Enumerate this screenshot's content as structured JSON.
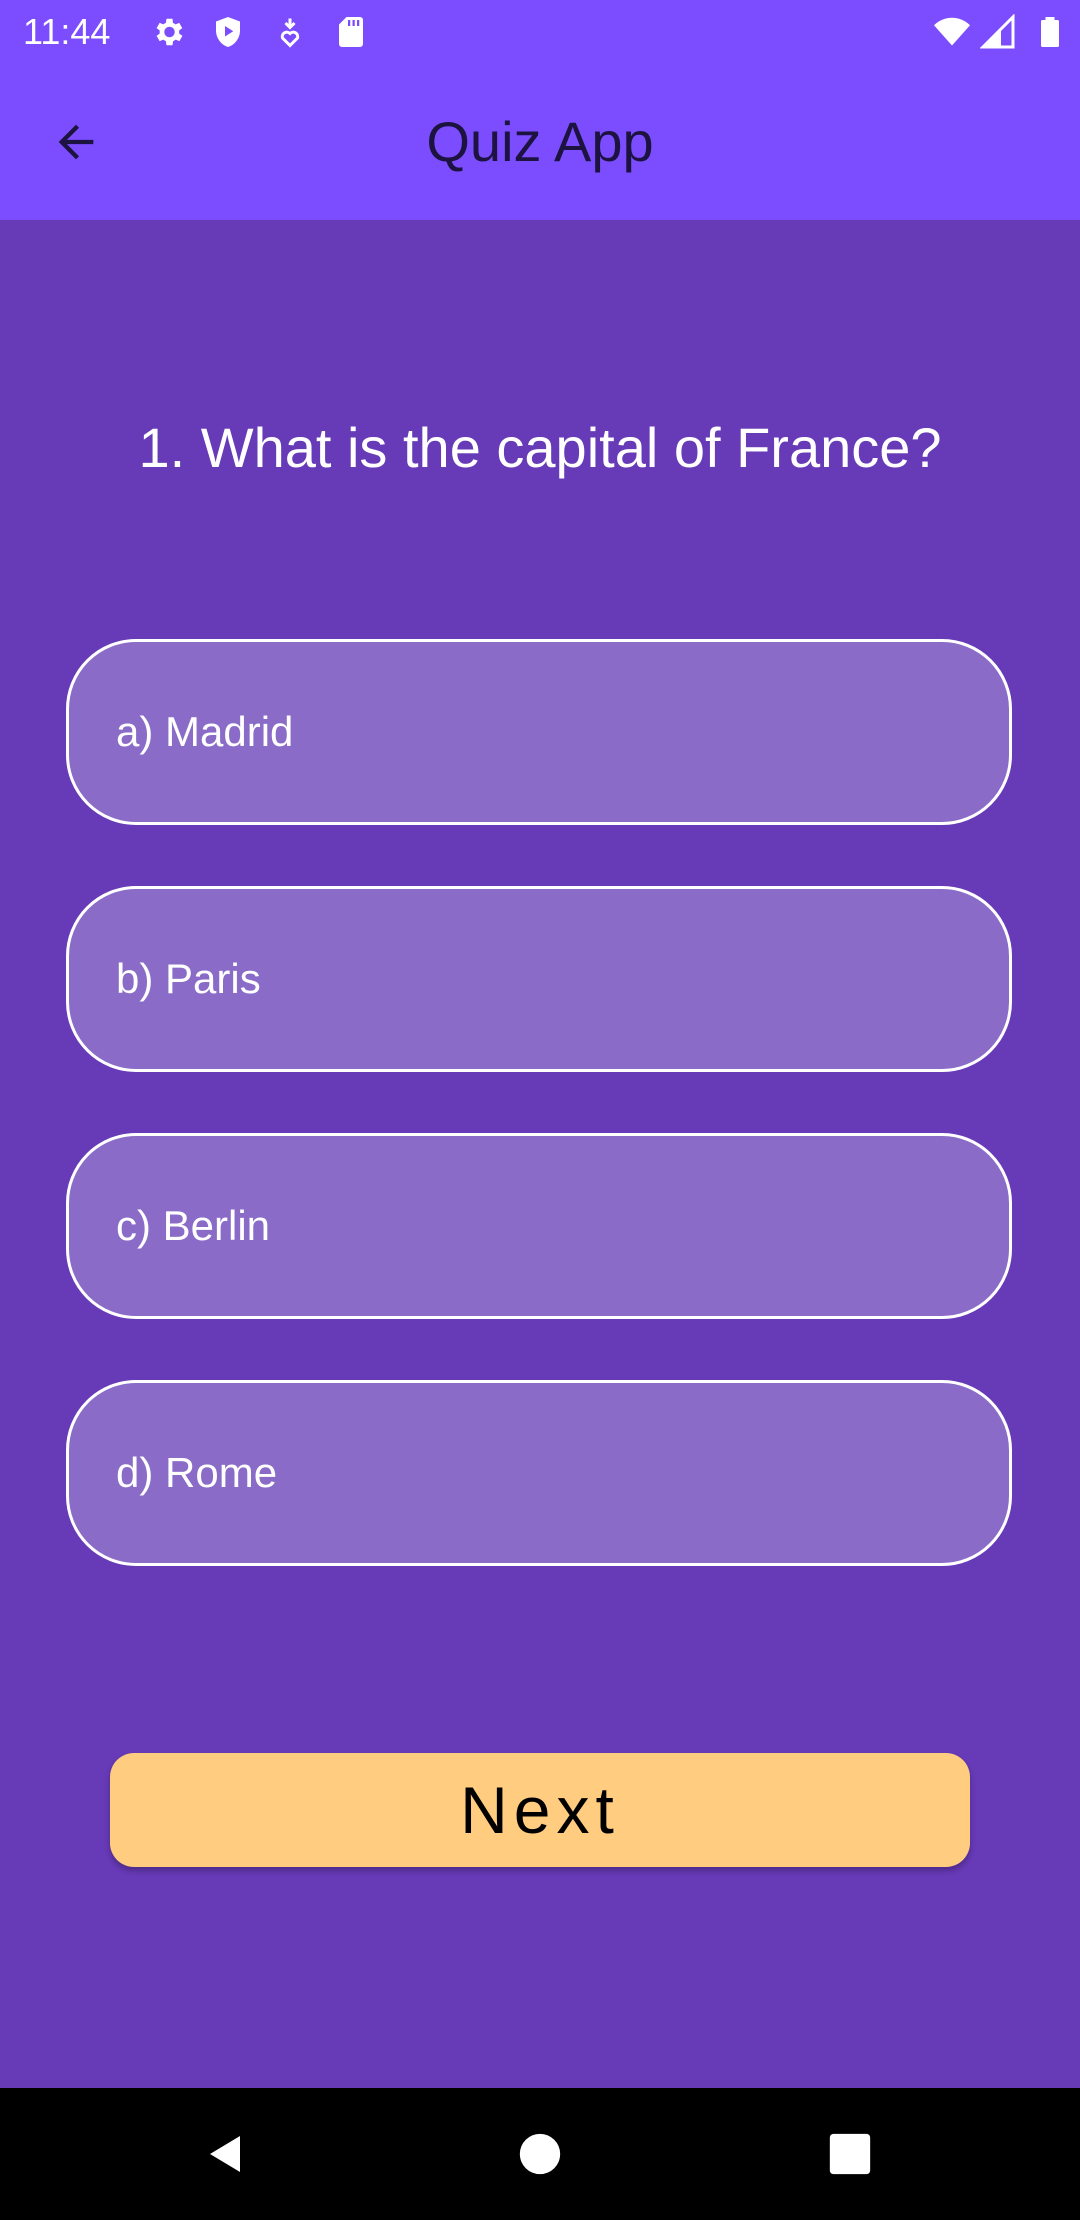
{
  "status_bar": {
    "time": "11:44",
    "left_icons": [
      "gear-icon",
      "shield-play-icon",
      "download-heart-icon",
      "sd-card-icon"
    ],
    "right_icons": [
      "wifi-icon",
      "signal-icon",
      "battery-icon"
    ]
  },
  "app_bar": {
    "title": "Quiz App",
    "back_icon": "arrow-back-icon",
    "color": "#7C4DFF"
  },
  "quiz": {
    "question": "1. What is the capital of France?",
    "options": [
      {
        "label": "a) Madrid"
      },
      {
        "label": "b) Paris"
      },
      {
        "label": "c) Berlin"
      },
      {
        "label": "d) Rome"
      }
    ],
    "next_label": "Next"
  },
  "colors": {
    "background": "#673AB7",
    "option_fill": "#8A6CC8",
    "next_button": "#FFCC80"
  },
  "nav_bar": {
    "icons": [
      "back-triangle-icon",
      "home-circle-icon",
      "recents-square-icon"
    ]
  }
}
